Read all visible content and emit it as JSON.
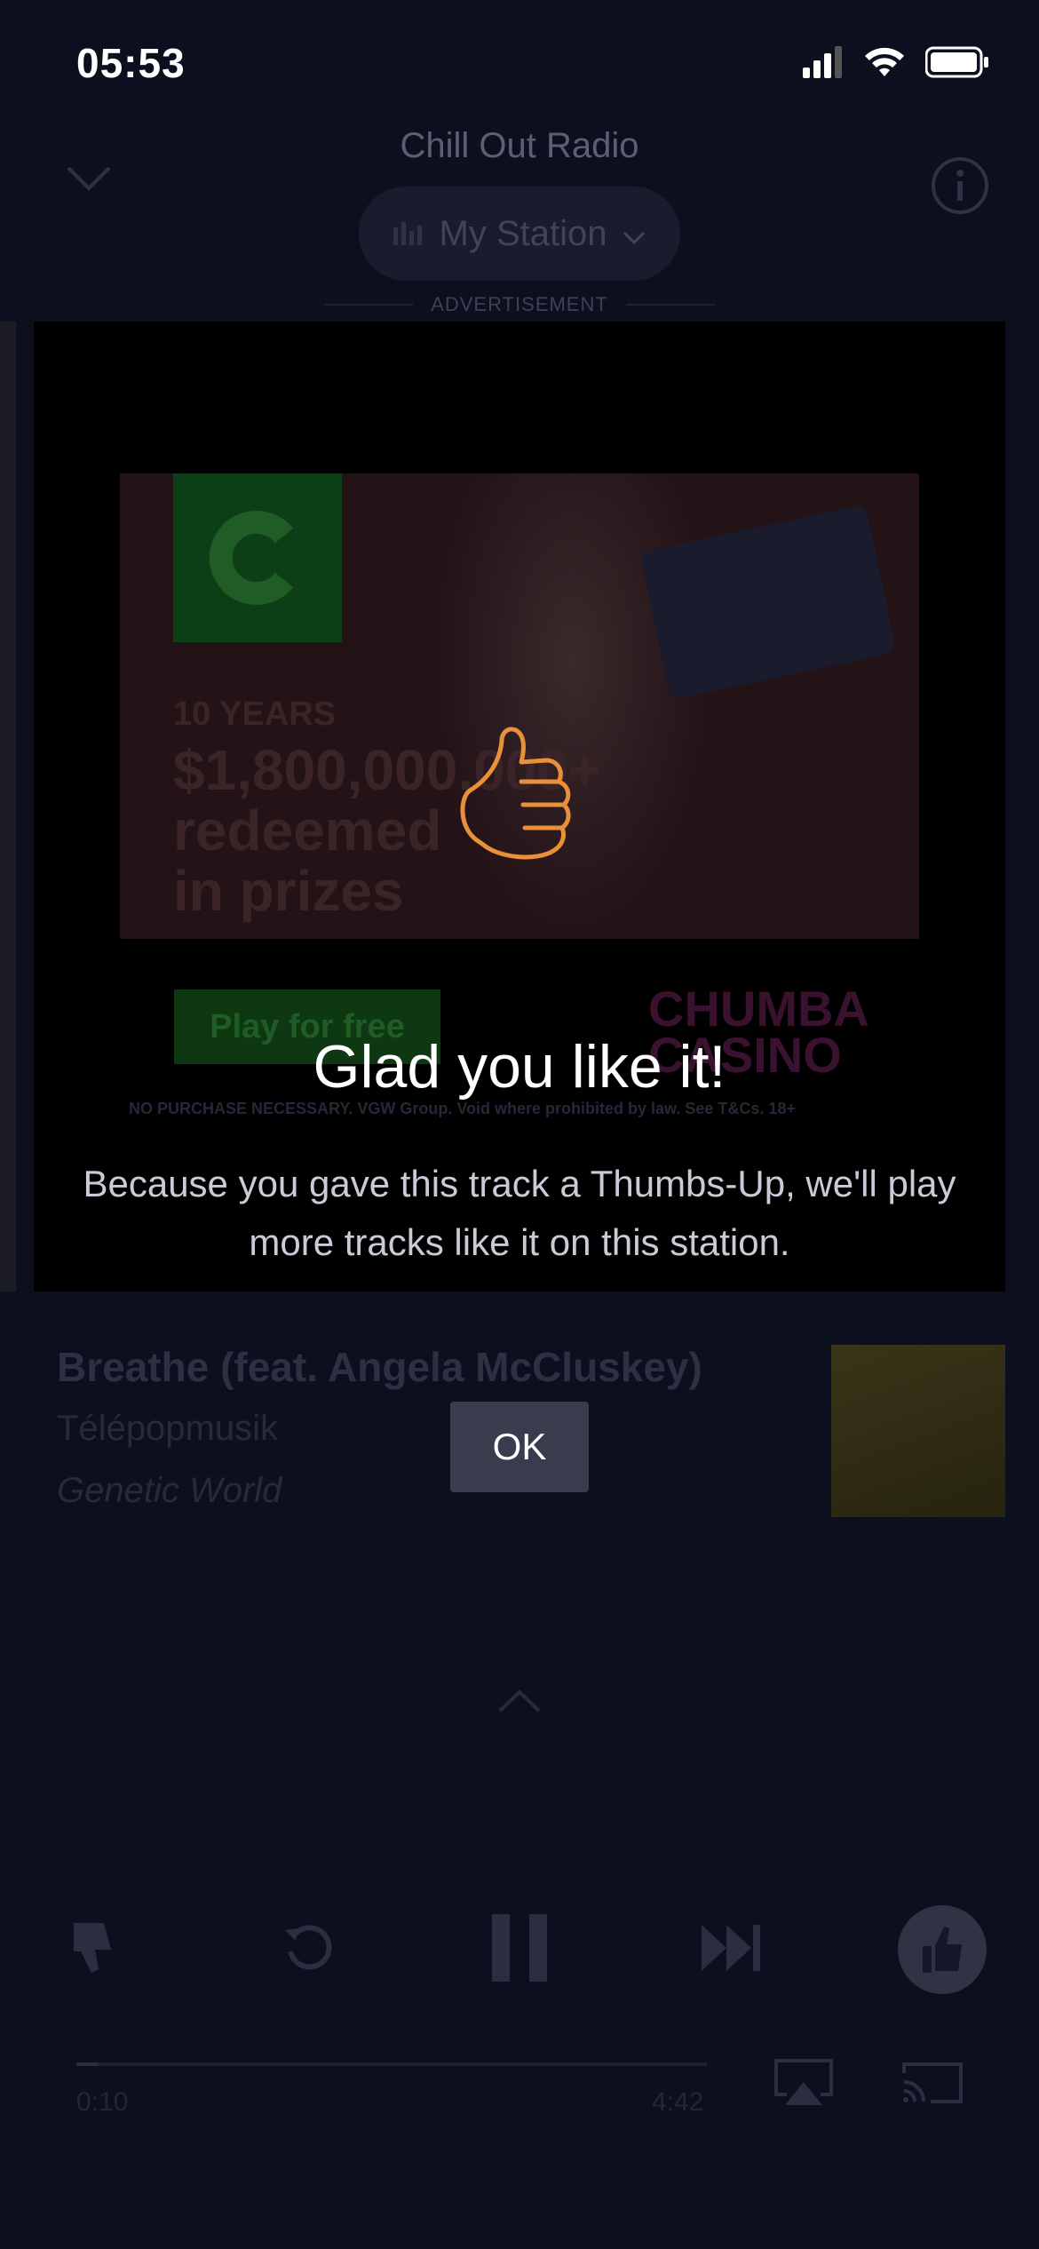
{
  "status_bar": {
    "time": "05:53"
  },
  "header": {
    "station_name": "Chill Out Radio",
    "mode_label": "My Station",
    "ad_label": "ADVERTISEMENT"
  },
  "ad": {
    "years": "10 YEARS",
    "headline_1": "$1,800,000,000+",
    "headline_2": "redeemed",
    "headline_3": "in prizes",
    "cta": "Play for free",
    "brand_1": "CHUMBA",
    "brand_2": "CASINO",
    "fine_print": "NO PURCHASE NECESSARY. VGW Group. Void where prohibited by law. See T&Cs. 18+"
  },
  "track": {
    "title": "Breathe (feat. Angela McCluskey)",
    "artist": "Télépopmusik",
    "album": "Genetic World"
  },
  "player": {
    "elapsed": "0:10",
    "duration": "4:42",
    "progress_fraction": 0.035
  },
  "modal": {
    "title": "Glad you like it!",
    "body": "Because you gave this track a Thumbs-Up, we'll play more tracks like it on this station.",
    "ok_label": "OK"
  },
  "colors": {
    "accent_orange": "#e8913a",
    "background": "#0c0f1e"
  },
  "icons": [
    "signal-icon",
    "wifi-icon",
    "battery-icon",
    "chevron-down-icon",
    "info-icon",
    "thumbs-up-icon",
    "thumbs-down-icon",
    "replay-icon",
    "pause-icon",
    "skip-icon",
    "airplay-icon",
    "cast-icon",
    "chevron-up-icon"
  ]
}
